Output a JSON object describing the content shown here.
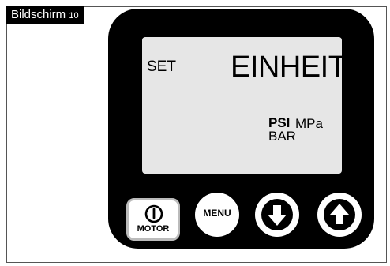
{
  "caption": {
    "title": "Bildschirm",
    "number": "10"
  },
  "display": {
    "left_label": "SET",
    "title": "EINHEIT",
    "units": {
      "selected": "PSI",
      "other": "MPa",
      "third": "BAR"
    }
  },
  "buttons": {
    "motor_label": "MOTOR",
    "menu_label": "MENU",
    "down_icon": "arrow-down-icon",
    "up_icon": "arrow-up-icon",
    "power_icon": "power-icon"
  },
  "colors": {
    "bezel": "#000000",
    "screen": "#e6e6e6",
    "button": "#ffffff",
    "caption_bg": "#000000",
    "caption_text": "#ffffff"
  }
}
